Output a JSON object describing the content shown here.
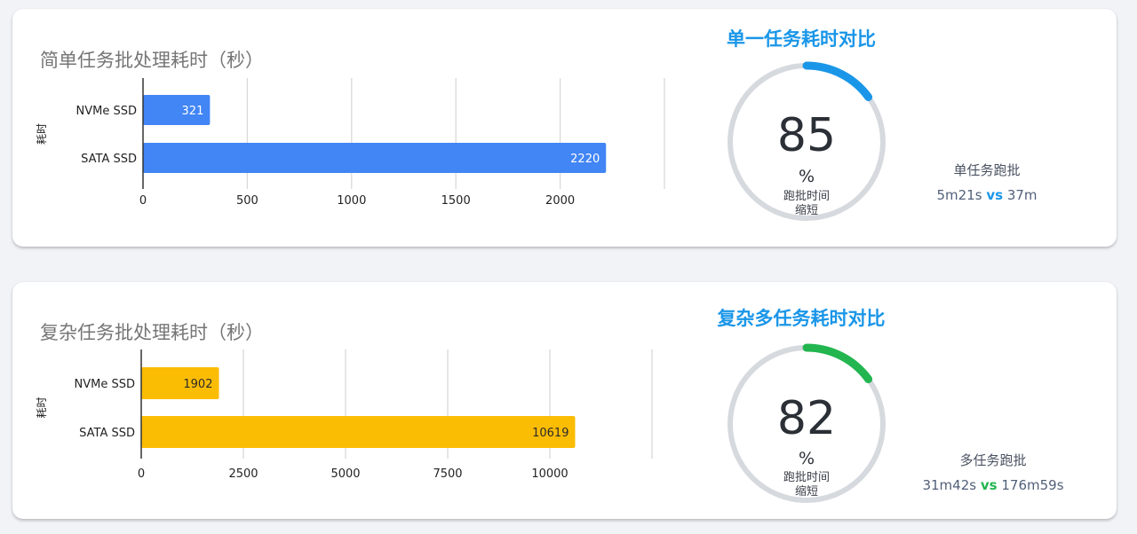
{
  "panels": [
    {
      "chart_title": "简单任务批处理耗时（秒）",
      "gauge_title": "单一任务耗时对比",
      "gauge_value": "85",
      "gauge_unit": "%",
      "gauge_label_line1": "跑批时间",
      "gauge_label_line2": "缩短",
      "gauge_fraction": 0.15,
      "gauge_color": "#1a96e8",
      "side_label": "单任务跑批",
      "compare_a": "5m21s",
      "compare_vs": "vs",
      "compare_b": "37m",
      "vs_color": "#1a96e8"
    },
    {
      "chart_title": "复杂任务批处理耗时（秒）",
      "gauge_title": "复杂多任务耗时对比",
      "gauge_value": "82",
      "gauge_unit": "%",
      "gauge_label_line1": "跑批时间",
      "gauge_label_line2": "缩短",
      "gauge_fraction": 0.15,
      "gauge_color": "#22b550",
      "side_label": "多任务跑批",
      "compare_a": "31m42s",
      "compare_vs": "vs",
      "compare_b": "176m59s",
      "vs_color": "#22b550"
    }
  ],
  "chart_data": [
    {
      "type": "bar",
      "orientation": "horizontal",
      "title": "简单任务批处理耗时（秒）",
      "ylabel": "耗时",
      "xlabel": "",
      "categories": [
        "NVMe SSD",
        "SATA SSD"
      ],
      "values": [
        321,
        2220
      ],
      "xticks": [
        0,
        500,
        1000,
        1500,
        2000
      ],
      "xlim": [
        0,
        2500
      ],
      "bar_color": "#4285f4",
      "label_color": "#ffffff",
      "grid": true
    },
    {
      "type": "bar",
      "orientation": "horizontal",
      "title": "复杂任务批处理耗时（秒）",
      "ylabel": "耗时",
      "xlabel": "",
      "categories": [
        "NVMe SSD",
        "SATA SSD"
      ],
      "values": [
        1902,
        10619
      ],
      "xticks": [
        0,
        2500,
        5000,
        7500,
        10000
      ],
      "xlim": [
        0,
        12500
      ],
      "bar_color": "#fbbc04",
      "label_color": "#2b2b2b",
      "grid": true
    }
  ]
}
